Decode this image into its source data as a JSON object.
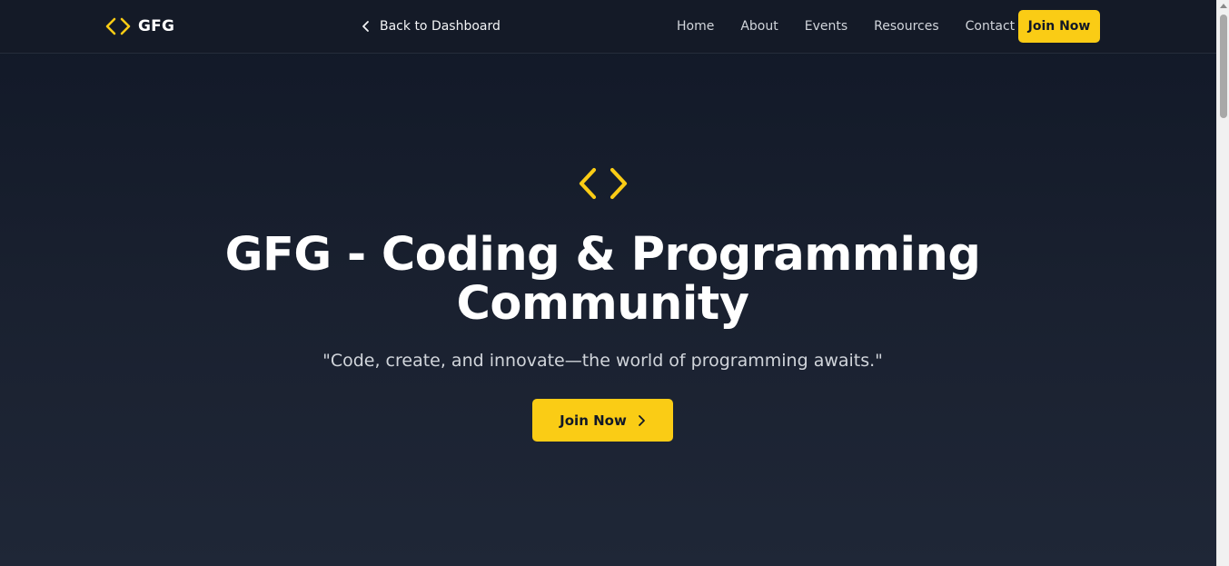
{
  "navbar": {
    "brand": {
      "icon": "code-brackets-icon",
      "name": "GFG"
    },
    "back_link": {
      "icon": "chevron-left-icon",
      "label": "Back to Dashboard"
    },
    "links": [
      {
        "label": "Home"
      },
      {
        "label": "About"
      },
      {
        "label": "Events"
      },
      {
        "label": "Resources"
      },
      {
        "label": "Contact"
      }
    ],
    "join_button": "Join Now"
  },
  "hero": {
    "icon": "code-brackets-icon",
    "title_line1": "GFG - Coding & Programming",
    "title_line2": "Community",
    "tagline": "\"Code, create, and innovate—the world of programming awaits.\"",
    "join_button": {
      "label": "Join Now",
      "icon": "chevron-right-icon"
    }
  },
  "colors": {
    "accent": "#facc15",
    "background_top": "#111827",
    "background_bottom": "#1f2737",
    "navbar": "#141a27"
  }
}
